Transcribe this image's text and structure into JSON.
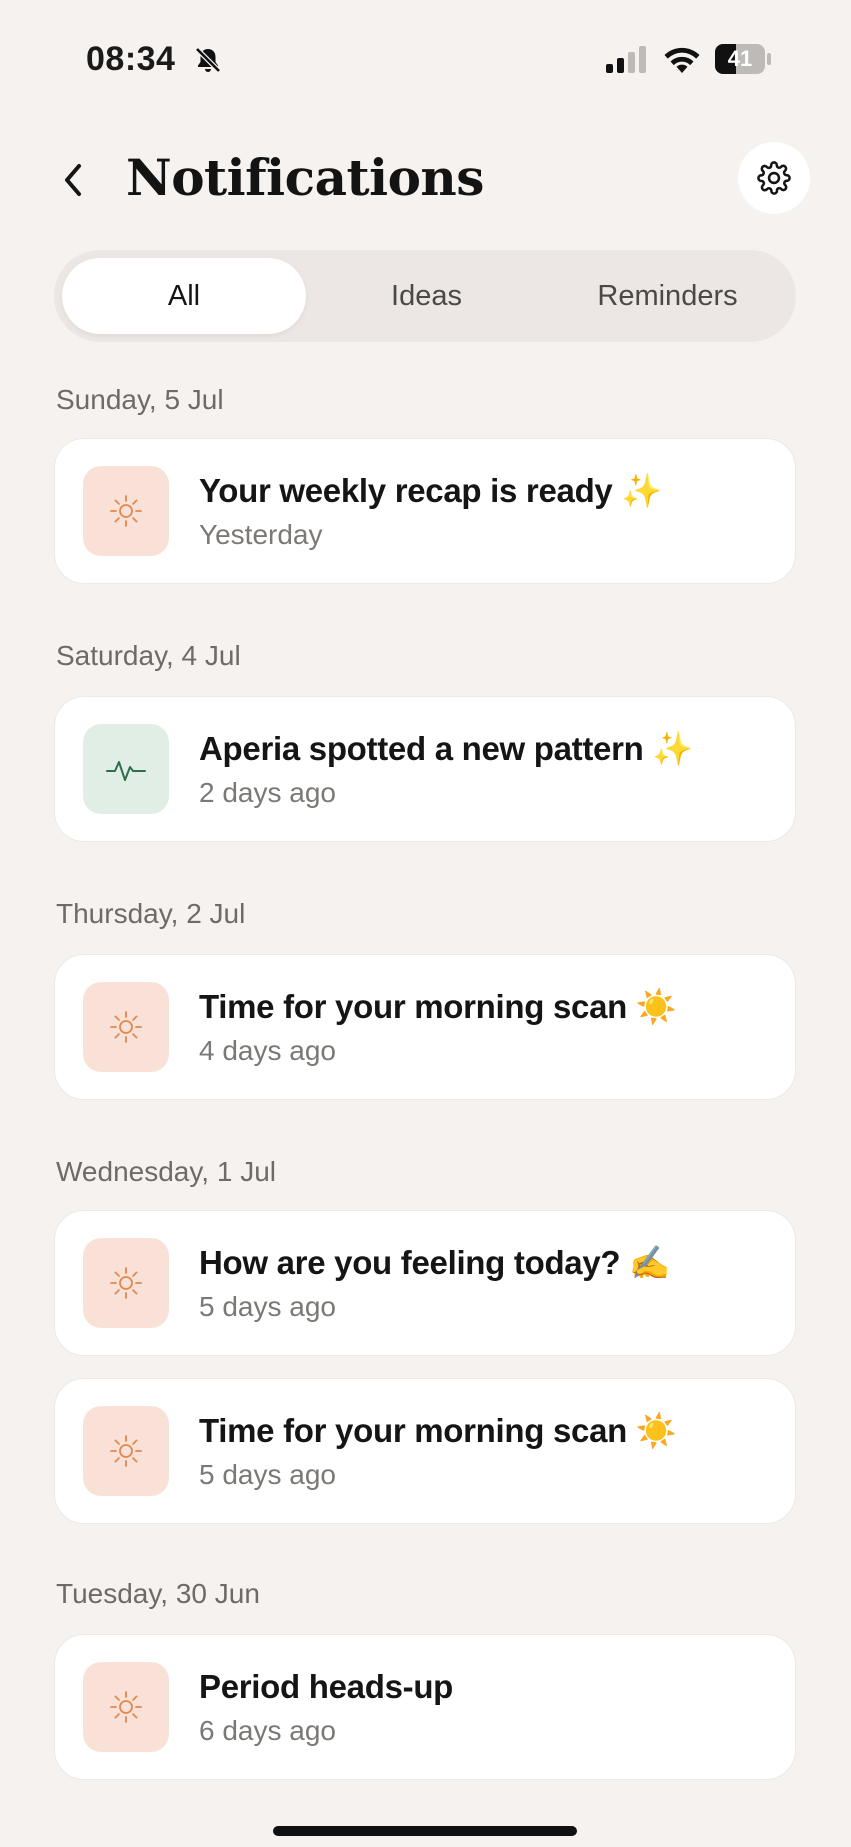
{
  "status_bar": {
    "time": "08:34",
    "battery": "41"
  },
  "header": {
    "title": "Notifications"
  },
  "tabs": [
    {
      "label": "All",
      "active": true
    },
    {
      "label": "Ideas",
      "active": false
    },
    {
      "label": "Reminders",
      "active": false
    }
  ],
  "groups": [
    {
      "date": "Sunday, 5 Jul",
      "items": [
        {
          "title": "Your weekly recap is ready ✨",
          "time": "Yesterday",
          "icon": "sun-icon"
        }
      ]
    },
    {
      "date": "Saturday, 4 Jul",
      "items": [
        {
          "title": "Aperia spotted a new pattern ✨",
          "time": "2 days ago",
          "icon": "pulse-icon"
        }
      ]
    },
    {
      "date": "Thursday, 2 Jul",
      "items": [
        {
          "title": "Time for your morning scan ☀️",
          "time": "4 days ago",
          "icon": "sun-icon"
        }
      ]
    },
    {
      "date": "Wednesday, 1 Jul",
      "items": [
        {
          "title": "How are you feeling today? ✍️",
          "time": "5 days ago",
          "icon": "sun-icon"
        },
        {
          "title": "Time for your morning scan ☀️",
          "time": "5 days ago",
          "icon": "sun-icon"
        }
      ]
    },
    {
      "date": "Tuesday, 30 Jun",
      "items": [
        {
          "title": "Period heads-up",
          "time": "6 days ago",
          "icon": "sun-icon"
        }
      ]
    }
  ],
  "colors": {
    "background": "#f5f2f0",
    "sun_icon": "#e0884f",
    "sun_bg": "#f9e1d7",
    "pulse_icon": "#2e6e4c",
    "pulse_bg": "#e0eee6"
  }
}
